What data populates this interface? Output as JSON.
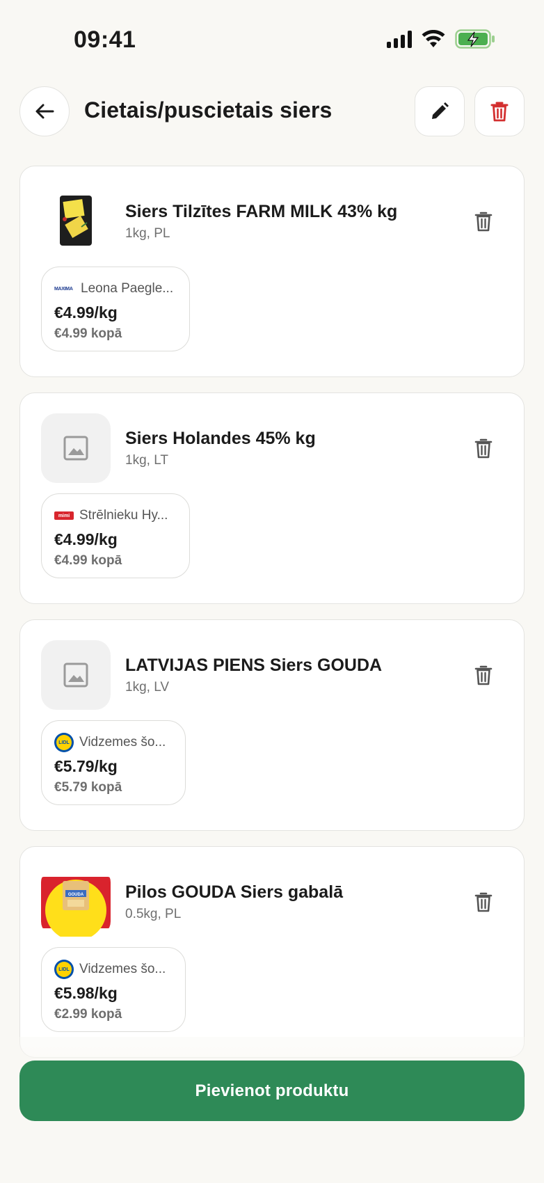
{
  "status_bar": {
    "time": "09:41"
  },
  "header": {
    "title": "Cietais/puscietais siers"
  },
  "products": [
    {
      "name": "Siers Tilzītes FARM MILK 43% kg",
      "meta": "1kg, PL",
      "image": "cheese-photo",
      "offer": {
        "store_logo": "MAXIMA",
        "store_name": "Leona Paegle...",
        "price_per_unit": "€4.99/kg",
        "total": "€4.99 kopā"
      }
    },
    {
      "name": "Siers Holandes 45% kg",
      "meta": "1kg, LT",
      "image": "image-placeholder-icon",
      "offer": {
        "store_logo": "mimi",
        "store_name": "Strēlnieku Hy...",
        "price_per_unit": "€4.99/kg",
        "total": "€4.99 kopā"
      }
    },
    {
      "name": "LATVIJAS PIENS Siers GOUDA",
      "meta": "1kg, LV",
      "image": "image-placeholder-icon",
      "offer": {
        "store_logo": "LIDL",
        "store_name": "Vidzemes šo...",
        "price_per_unit": "€5.79/kg",
        "total": "€5.79 kopā"
      }
    },
    {
      "name": "Pilos GOUDA Siers gabalā",
      "meta": "0.5kg, PL",
      "image": "gouda-package-photo",
      "image_label": "GOUDA",
      "offer": {
        "store_logo": "LIDL",
        "store_name": "Vidzemes šo...",
        "price_per_unit": "€5.98/kg",
        "total": "€2.99 kopā"
      }
    }
  ],
  "footer": {
    "add_button_label": "Pievienot produktu"
  },
  "colors": {
    "primary": "#2e8a57",
    "danger": "#d32f2f",
    "background": "#f9f8f4"
  }
}
